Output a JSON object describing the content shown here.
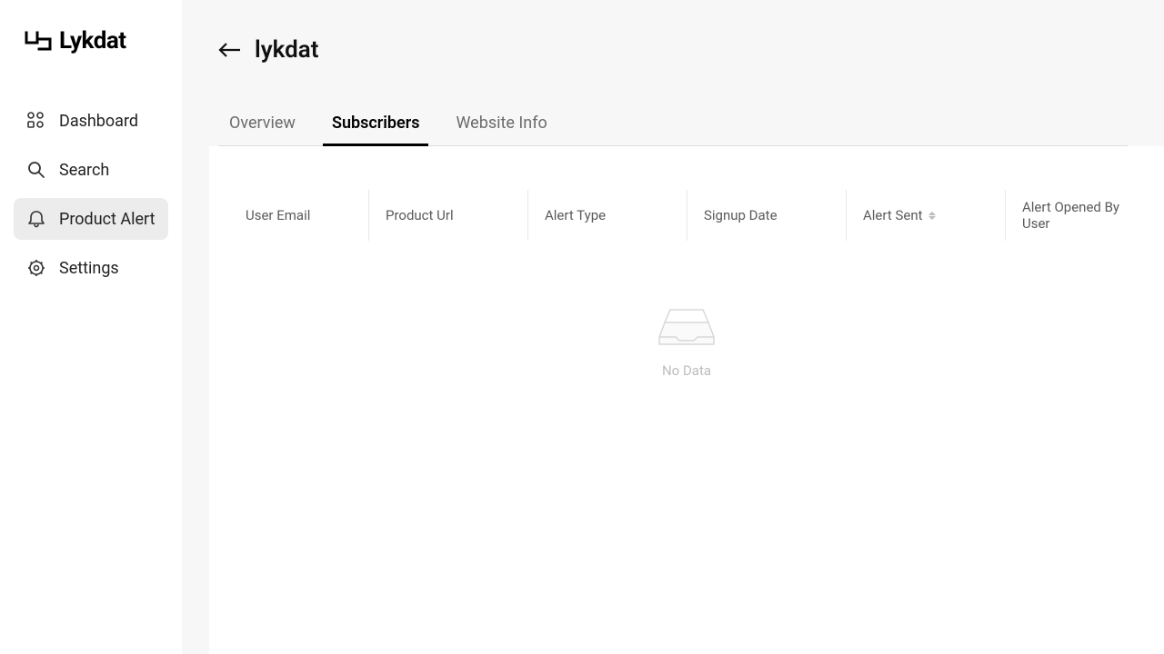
{
  "brand": "Lykdat",
  "sidebar": {
    "items": [
      {
        "label": "Dashboard",
        "icon": "grid-icon",
        "active": false
      },
      {
        "label": "Search",
        "icon": "search-icon",
        "active": false
      },
      {
        "label": "Product Alert",
        "icon": "bell-icon",
        "active": true
      },
      {
        "label": "Settings",
        "icon": "gear-icon",
        "active": false
      }
    ]
  },
  "header": {
    "title": "lykdat"
  },
  "tabs": [
    {
      "label": "Overview",
      "active": false
    },
    {
      "label": "Subscribers",
      "active": true
    },
    {
      "label": "Website Info",
      "active": false
    }
  ],
  "table": {
    "columns": [
      {
        "label": "User Email",
        "sortable": false
      },
      {
        "label": "Product Url",
        "sortable": false
      },
      {
        "label": "Alert Type",
        "sortable": false
      },
      {
        "label": "Signup Date",
        "sortable": false
      },
      {
        "label": "Alert Sent",
        "sortable": true
      },
      {
        "label": "Alert Opened By User",
        "sortable": false
      }
    ],
    "rows": [],
    "empty_label": "No Data"
  }
}
